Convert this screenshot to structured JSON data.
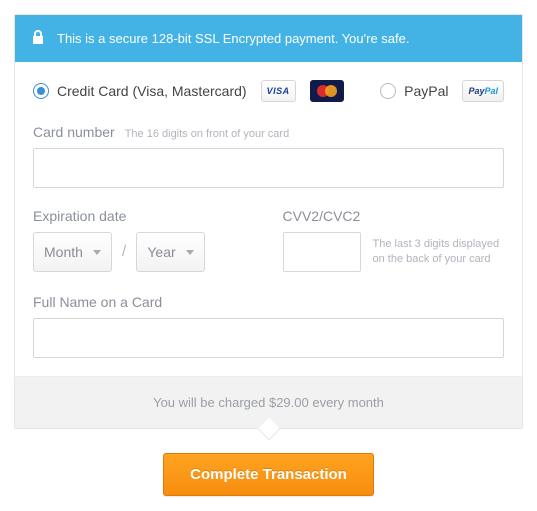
{
  "secure": {
    "message": "This is a secure 128-bit SSL Encrypted payment. You're safe."
  },
  "payment": {
    "credit_card_label": "Credit Card (Visa, Mastercard)",
    "paypal_label": "PayPal",
    "visa_badge": "VISA",
    "paypal_badge_pay": "Pay",
    "paypal_badge_pal": "Pal"
  },
  "card_number": {
    "label": "Card number",
    "hint": "The 16 digits on front of your card",
    "value": ""
  },
  "expiration": {
    "label": "Expiration date",
    "month_value": "Month",
    "year_value": "Year",
    "separator": "/"
  },
  "cvv": {
    "label": "CVV2/CVC2",
    "hint": "The last 3 digits displayed on the back of your card",
    "value": ""
  },
  "fullname": {
    "label": "Full Name on a Card",
    "value": ""
  },
  "charge_notice": "You will be charged $29.00 every month",
  "cta_label": "Complete Transaction"
}
